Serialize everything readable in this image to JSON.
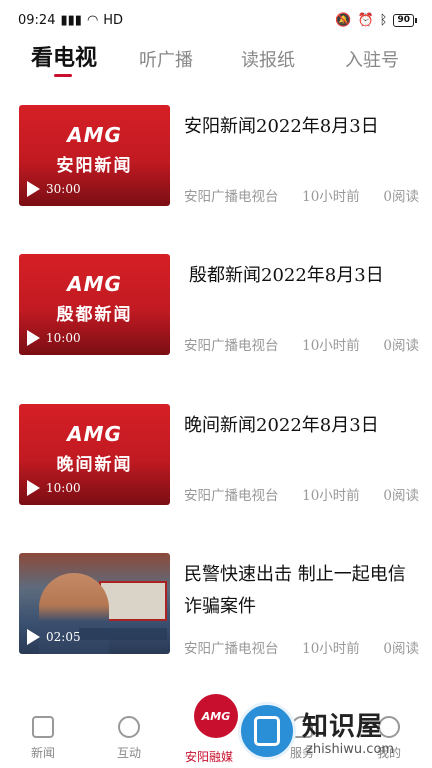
{
  "status_bar": {
    "time": "09:24",
    "network": "HD",
    "battery": "90"
  },
  "tabs": [
    {
      "label": "看电视"
    },
    {
      "label": "听广播"
    },
    {
      "label": "读报纸"
    },
    {
      "label": "入驻号"
    }
  ],
  "news": [
    {
      "title": "安阳新闻2022年8月3日",
      "thumb_brand": "AMG",
      "thumb_title": "安阳新闻",
      "duration": "30:00",
      "source": "安阳广播电视台",
      "time": "10小时前",
      "reads": "0阅读"
    },
    {
      "title": "殷都新闻2022年8月3日",
      "thumb_brand": "AMG",
      "thumb_title": "殷都新闻",
      "duration": "10:00",
      "source": "安阳广播电视台",
      "time": "10小时前",
      "reads": "0阅读"
    },
    {
      "title": "晚间新闻2022年8月3日",
      "thumb_brand": "AMG",
      "thumb_title": "晚间新闻",
      "duration": "10:00",
      "source": "安阳广播电视台",
      "time": "10小时前",
      "reads": "0阅读"
    },
    {
      "title": "民警快速出击 制止一起电信诈骗案件",
      "duration": "02:05",
      "source": "安阳广播电视台",
      "time": "10小时前",
      "reads": "0阅读"
    }
  ],
  "bottom_nav": {
    "items": [
      {
        "label": "新闻",
        "icon": "news-icon"
      },
      {
        "label": "互动",
        "icon": "compass-icon"
      },
      {
        "label": "安阳融媒",
        "icon": "amg-logo-icon",
        "logo": "AMG"
      },
      {
        "label": "服务",
        "icon": "heart-icon"
      },
      {
        "label": "我的",
        "icon": "profile-icon"
      }
    ]
  },
  "watermark": {
    "text": "知识屋",
    "url": "zhishiwu.com"
  },
  "colors": {
    "accent": "#c8102e"
  }
}
